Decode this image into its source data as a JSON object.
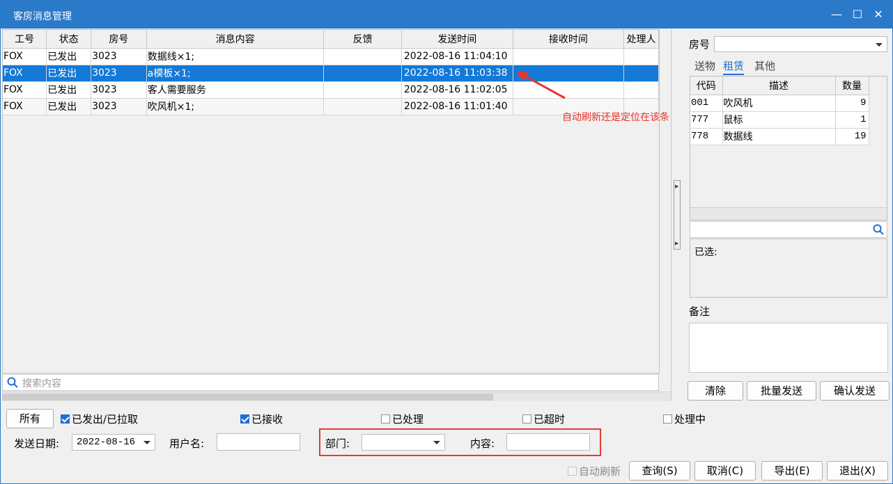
{
  "window": {
    "title": "客房消息管理",
    "controls": {
      "minimize": "—",
      "maximize": "☐",
      "close": "✕"
    }
  },
  "grid": {
    "columns": [
      "工号",
      "状态",
      "房号",
      "消息内容",
      "反馈",
      "发送时间",
      "接收时间",
      "处理人"
    ],
    "rows": [
      {
        "emp": "FOX",
        "status": "已发出",
        "room": "3023",
        "content": "数据线×1;",
        "feedback": "",
        "send_time": "2022-08-16 11:04:10",
        "recv_time": "",
        "handler": ""
      },
      {
        "emp": "FOX",
        "status": "已发出",
        "room": "3023",
        "content": "a模板×1;",
        "feedback": "",
        "send_time": "2022-08-16 11:03:38",
        "recv_time": "",
        "handler": ""
      },
      {
        "emp": "FOX",
        "status": "已发出",
        "room": "3023",
        "content": "客人需要服务",
        "feedback": "",
        "send_time": "2022-08-16 11:02:05",
        "recv_time": "",
        "handler": ""
      },
      {
        "emp": "FOX",
        "status": "已发出",
        "room": "3023",
        "content": "吹风机×1;",
        "feedback": "",
        "send_time": "2022-08-16 11:01:40",
        "recv_time": "",
        "handler": ""
      }
    ],
    "selected_row": 1,
    "search_placeholder": "搜索内容"
  },
  "annotation": {
    "text": "自动刷新还是定位在该条",
    "color": "#e8352f"
  },
  "right": {
    "room_label": "房号",
    "room_value": "",
    "tabs": [
      "送物",
      "租赁",
      "其他"
    ],
    "active_tab": 1,
    "items_columns": [
      "代码",
      "描述",
      "数量"
    ],
    "items": [
      {
        "code": "001",
        "desc": "吹风机",
        "qty": "9"
      },
      {
        "code": "777",
        "desc": "鼠标",
        "qty": "1"
      },
      {
        "code": "778",
        "desc": "数据线",
        "qty": "19"
      }
    ],
    "selected_label": "已选:",
    "remark_label": "备注",
    "buttons": {
      "clear": "清除",
      "batch_send": "批量发送",
      "confirm_send": "确认发送"
    }
  },
  "filters": {
    "all_button": "所有",
    "checkboxes": [
      {
        "label": "已发出/已拉取",
        "checked": true
      },
      {
        "label": "已接收",
        "checked": true
      },
      {
        "label": "已处理",
        "checked": false
      },
      {
        "label": "已超时",
        "checked": false
      },
      {
        "label": "处理中",
        "checked": false
      }
    ],
    "send_date_label": "发送日期:",
    "send_date_value": "2022-08-16",
    "username_label": "用户名:",
    "username_value": "",
    "department_label": "部门:",
    "department_value": "",
    "content_label": "内容:",
    "content_value": "",
    "auto_refresh_label": "自动刷新",
    "auto_refresh_checked": false
  },
  "bottom_buttons": {
    "query": "查询(S)",
    "cancel": "取消(C)",
    "export": "导出(E)",
    "exit": "退出(X)"
  },
  "colors": {
    "titlebar": "#2b79c9",
    "selection": "#1479d7",
    "accent": "#1f6ed4",
    "highlight_box": "#e53935"
  }
}
